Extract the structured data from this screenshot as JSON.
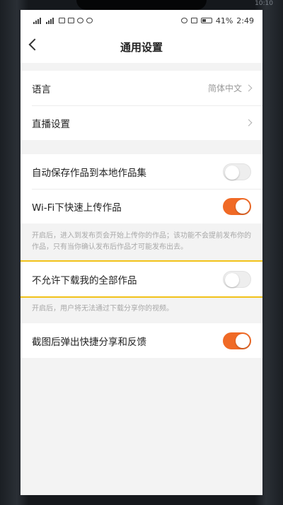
{
  "status_bar": {
    "battery": "41%",
    "time": "2:49"
  },
  "corner_time": "10:10",
  "nav": {
    "title": "通用设置"
  },
  "section1": [
    {
      "label": "语言",
      "value": "简体中文"
    },
    {
      "label": "直播设置",
      "value": ""
    }
  ],
  "section2": [
    {
      "label": "自动保存作品到本地作品集",
      "on": false
    },
    {
      "label": "Wi-Fi下快速上传作品",
      "on": true
    }
  ],
  "hint1": "开启后，进入到发布页会开始上传你的作品；该功能不会提前发布你的作品，只有当你确认发布后作品才可能发布出去。",
  "section3": {
    "label": "不允许下载我的全部作品",
    "on": false
  },
  "hint2": "开启后，用户将无法通过下载分享你的视频。",
  "section4": {
    "label": "截图后弹出快捷分享和反馈",
    "on": true
  },
  "colors": {
    "accent": "#f06a26",
    "highlight": "#f2c21a"
  }
}
